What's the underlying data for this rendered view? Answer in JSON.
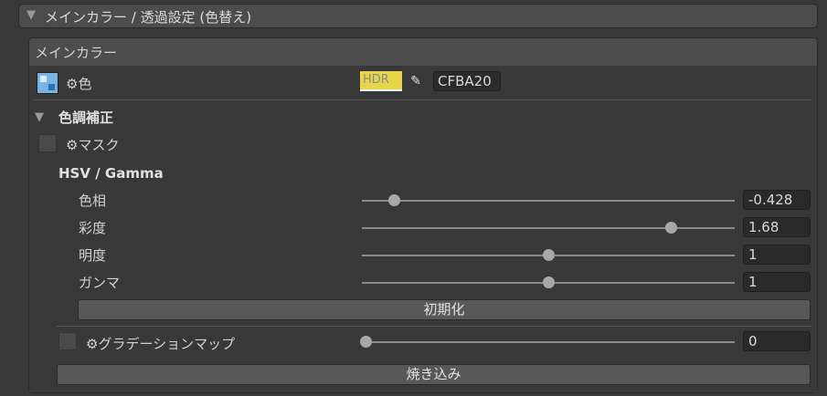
{
  "top_foldout": {
    "title": "メインカラー / 透過設定 (色替え)",
    "expanded_icon": "triangle-down-icon"
  },
  "section": {
    "title": "メインカラー"
  },
  "color_row": {
    "icon": "texture-icon",
    "label": "⚙色",
    "hdr_label": "HDR",
    "swatch_color": "#E7D64A",
    "eyedropper_icon": "eyedropper-icon",
    "hex_value": "CFBA20"
  },
  "color_adjust": {
    "title": "色調補正",
    "mask_label": "⚙マスク",
    "hsv_title": "HSV / Gamma",
    "sliders": [
      {
        "label": "色相",
        "value": "-0.428",
        "fraction": 0.086
      },
      {
        "label": "彩度",
        "value": "1.68",
        "fraction": 0.83
      },
      {
        "label": "明度",
        "value": "1",
        "fraction": 0.5
      },
      {
        "label": "ガンマ",
        "value": "1",
        "fraction": 0.5
      }
    ],
    "reset_label": "初期化",
    "gradation_label": "⚙グラデーションマップ",
    "gradation_value": "0",
    "gradation_fraction": 0.0
  },
  "bake_label": "焼き込み"
}
